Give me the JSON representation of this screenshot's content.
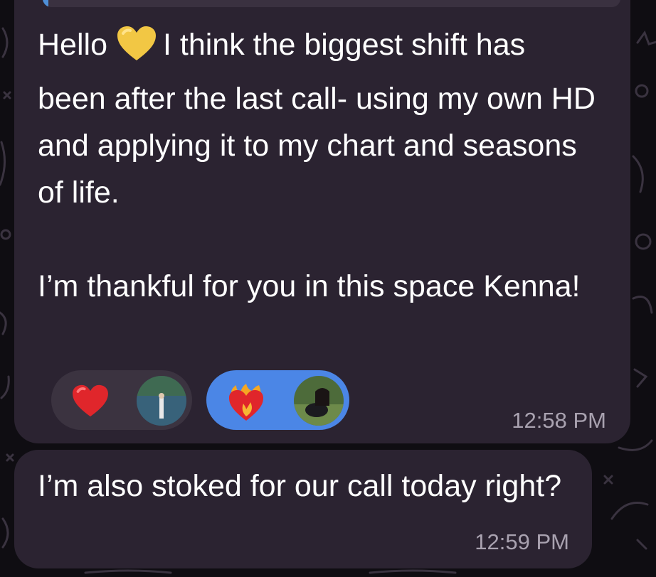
{
  "messages": [
    {
      "text_before_emoji": "Hello",
      "emoji": "yellow-heart",
      "text_after_emoji": "I think the biggest shift has been after the last call- using my own HD and applying it to my chart and seasons of life.\n\nI’m thankful for you in this space Kenna!",
      "time": "12:58 PM",
      "reactions": [
        {
          "emoji": "red-heart",
          "selected": false
        },
        {
          "emoji": "heart-on-fire",
          "selected": true
        }
      ]
    },
    {
      "text": "I’m also stoked for our call today right?",
      "time": "12:59 PM"
    }
  ],
  "colors": {
    "bubble": "#2b2331",
    "wallpaper": "#0f0d12",
    "reaction_selected": "#4b86e6",
    "reaction_default": "#3b3340",
    "time_text": "#a9a2b0"
  }
}
